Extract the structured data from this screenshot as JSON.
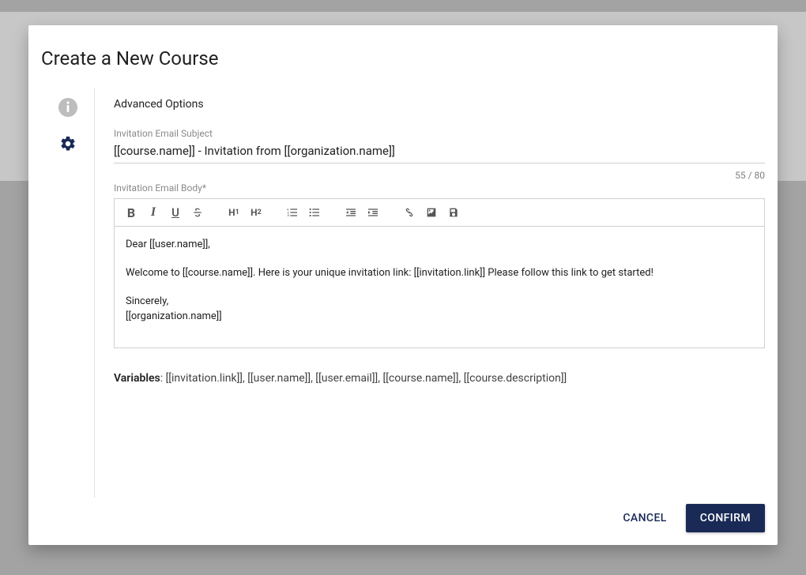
{
  "modal": {
    "title": "Create a New Course",
    "section_title": "Advanced Options",
    "subject_label": "Invitation Email Subject",
    "subject_value": "[[course.name]] - Invitation from [[organization.name]]",
    "char_count": "55 / 80",
    "body_label": "Invitation Email Body*",
    "body_line1": "Dear [[user.name]],",
    "body_line2": "Welcome to [[course.name]]. Here is your unique invitation link: [[invitation.link]] Please follow this link to get started!",
    "body_line3": "Sincerely,",
    "body_line4": "[[organization.name]]",
    "variables_label": "Variables",
    "variables_list": ": [[invitation.link]], [[user.name]], [[user.email]], [[course.name]], [[course.description]]",
    "cancel": "CANCEL",
    "confirm": "CONFIRM"
  },
  "toolbar": {
    "bold": "B",
    "italic": "I",
    "underline": "U",
    "h1": "H",
    "h1_sub": "1",
    "h2": "H",
    "h2_sub": "2"
  }
}
